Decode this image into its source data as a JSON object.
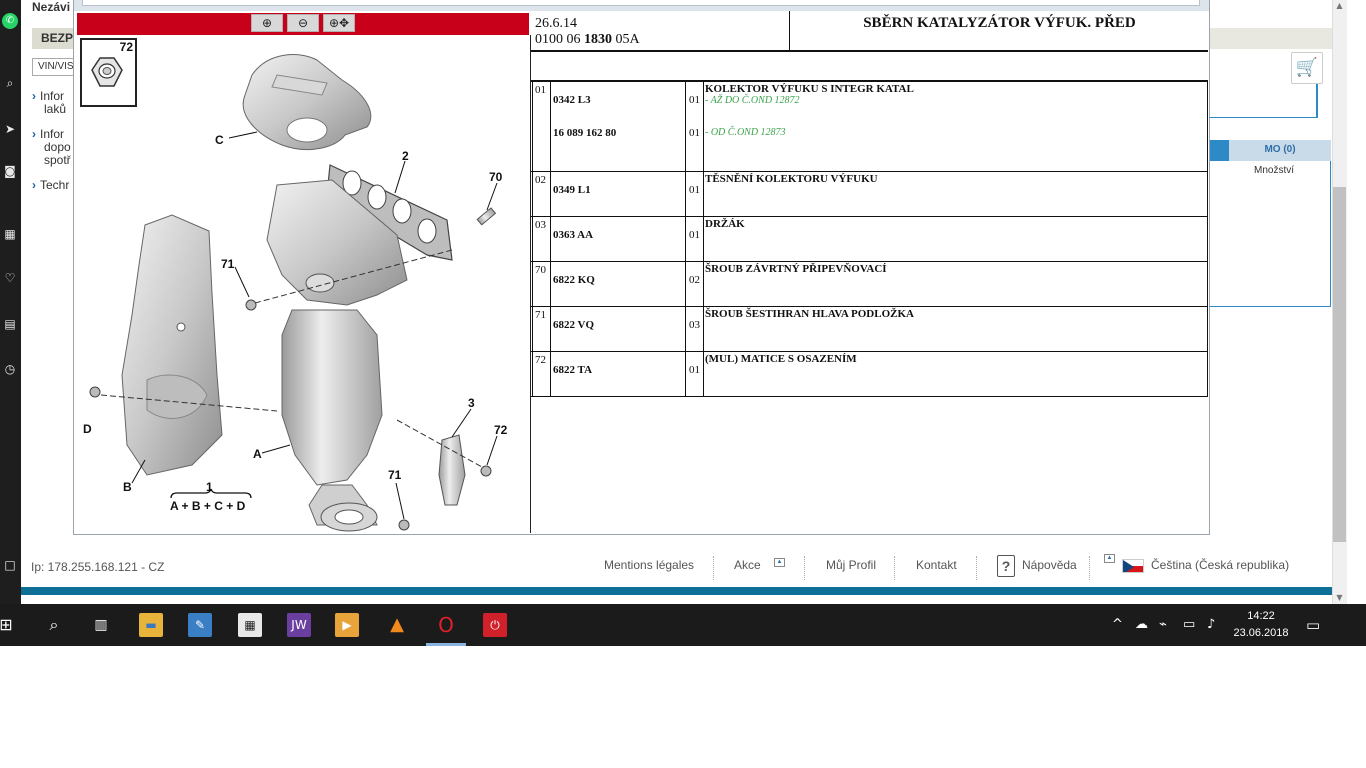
{
  "page": {
    "title": "Nezávi",
    "tab_label": "BEZP",
    "vin_placeholder": "VIN/VIS",
    "info_items": [
      [
        "Infor",
        "laků"
      ],
      [
        "Infor",
        "dopo",
        "spotř"
      ],
      [
        "Techr"
      ]
    ],
    "cart_icon": "shopping-cart-icon",
    "mo_tab_label": "MO (0)",
    "mo_qty_label": "Množství"
  },
  "footer": {
    "ip": "Ip: 178.255.168.121 - CZ",
    "links": {
      "mentions": "Mentions légales",
      "akce": "Akce",
      "profil": "Můj Profil",
      "kontakt": "Kontakt",
      "napoveda": "Nápověda",
      "language": "Čeština (Česká republika)"
    }
  },
  "popup": {
    "toolbar": {
      "zoom_in_icon": "zoom-in-icon",
      "zoom_out_icon": "zoom-out-icon",
      "zoom_pan_icon": "zoom-pan-icon"
    },
    "diagram": {
      "thumb_label": "72",
      "callouts": [
        "C",
        "2",
        "70",
        "71",
        "D",
        "B",
        "1",
        "A + B + C + D",
        "A",
        "3",
        "72",
        "71"
      ]
    },
    "header": {
      "date": "26.6.14",
      "ref_prefix": "0100 06 ",
      "ref_bold": "1830",
      "ref_suffix": " 05A",
      "title": "SBĚRN KATALYZÁTOR VÝFUK. PŘED"
    },
    "parts": [
      {
        "pos": "01",
        "ref": "0342 L3",
        "qty": "01",
        "desc": "KOLEKTOR VÝFUKU S INTEGR KATAL",
        "note": "- AŽ DO Č.OND 12872",
        "ref2": "16 089 162 80",
        "qty2": "01",
        "note2": "- OD Č.OND 12873"
      },
      {
        "pos": "02",
        "ref": "0349 L1",
        "qty": "01",
        "desc": "TĚSNĚNÍ KOLEKTORU VÝFUKU"
      },
      {
        "pos": "03",
        "ref": "0363 AA",
        "qty": "01",
        "desc": "DRŽÁK"
      },
      {
        "pos": "70",
        "ref": "6822 KQ",
        "qty": "02",
        "desc": "ŠROUB ZÁVRTNÝ PŘIPEVŇOVACÍ"
      },
      {
        "pos": "71",
        "ref": "6822 VQ",
        "qty": "03",
        "desc": "ŠROUB ŠESTIHRAN HLAVA PODLOŽKA"
      },
      {
        "pos": "72",
        "ref": "6822 TA",
        "qty": "01",
        "desc": "(MUL) MATICE S OSAZENÍM"
      }
    ]
  },
  "taskbar": {
    "apps": [
      "windows-start-icon",
      "search-icon",
      "task-view-icon",
      "file-explorer-icon",
      "paint-icon",
      "calculator-icon",
      "jw-app-icon",
      "media-player-icon",
      "vlc-icon",
      "opera-icon",
      "power-app-icon"
    ],
    "jw_label": "JW",
    "time": "14:22",
    "date": "23.06.2018"
  },
  "colors": {
    "toolbar_red": "#c8001a",
    "accent_blue": "#2e8ac6",
    "note_green": "#3aa34a",
    "footer_teal": "#0e6f97"
  }
}
